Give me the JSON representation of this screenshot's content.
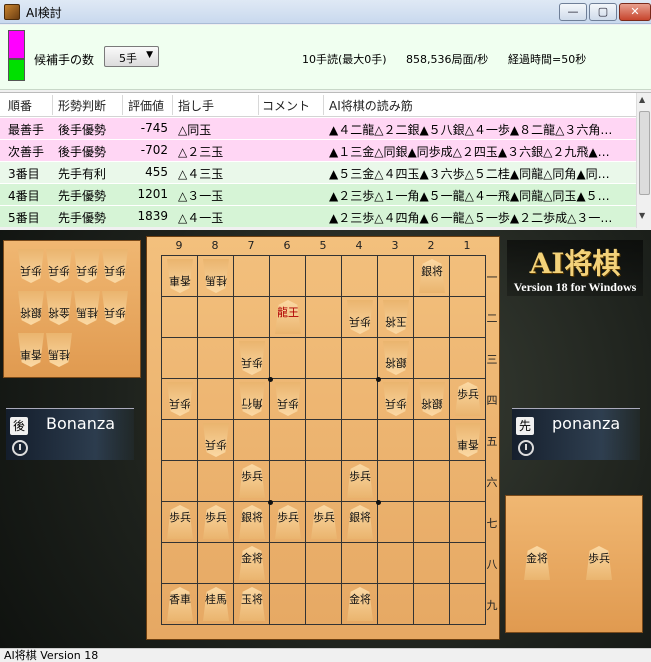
{
  "window": {
    "title": "AI検討",
    "min_label": "—",
    "max_label": "▢",
    "close_label": "✕"
  },
  "info": {
    "swatch_top_color": "#ff00ff",
    "swatch_bottom_color": "#00e000",
    "candidates_label": "候補手の数",
    "candidates_value": "5手",
    "candidates_arrow": "▼",
    "depth": "10手読(最大0手)",
    "speed": "858,536局面/秒",
    "elapsed": "経過時間=50秒"
  },
  "table": {
    "headers": [
      "順番",
      "形勢判断",
      "評価値",
      "指し手",
      "コメント",
      "AI将棋の読み筋"
    ],
    "rows": [
      {
        "rank": "最善手",
        "judge": "後手優勢",
        "value": "-745",
        "move": "△同玉",
        "pv": "▲４二龍△２二銀▲５八銀△４一歩▲８二龍△３六角…",
        "bg": "#ffd6f4"
      },
      {
        "rank": "次善手",
        "judge": "後手優勢",
        "value": "-702",
        "move": "△２三玉",
        "pv": "▲１三金△同銀▲同歩成△２四玉▲３六銀△２九飛▲…",
        "bg": "#ffd6f4"
      },
      {
        "rank": "3番目",
        "judge": "先手有利",
        "value": "455",
        "move": "△４三玉",
        "pv": "▲５三金△４四玉▲３六歩△５二桂▲同龍△同角▲同…",
        "bg": "#eaf8ea"
      },
      {
        "rank": "4番目",
        "judge": "先手優勢",
        "value": "1201",
        "move": "△３一玉",
        "pv": "▲２三歩△１一角▲５一龍△４一飛▲同龍△同玉▲５…",
        "bg": "#d6f4d6"
      },
      {
        "rank": "5番目",
        "judge": "先手優勢",
        "value": "1839",
        "move": "△４一玉",
        "pv": "▲２三歩△４四角▲６一龍△５一歩▲２二歩成△３一…",
        "bg": "#d6f4d6"
      }
    ],
    "scroll_up": "▲",
    "scroll_down": "▼"
  },
  "game": {
    "logo_title": "AI将棋",
    "logo_version": "Version 18 for Windows",
    "gote": {
      "tag": "後",
      "name": "Bonanza"
    },
    "sente": {
      "tag": "先",
      "name": "ponanza"
    },
    "col_labels": [
      "9",
      "8",
      "7",
      "6",
      "5",
      "4",
      "3",
      "2",
      "1"
    ],
    "row_labels": [
      "一",
      "二",
      "三",
      "四",
      "五",
      "六",
      "七",
      "八",
      "九"
    ],
    "board": [
      {
        "file": 9,
        "rank": 1,
        "t": "香車",
        "side": "gote"
      },
      {
        "file": 8,
        "rank": 1,
        "t": "桂馬",
        "side": "gote"
      },
      {
        "file": 2,
        "rank": 1,
        "t": "銀将",
        "side": "sente"
      },
      {
        "file": 6,
        "rank": 2,
        "t": "龍王",
        "side": "sente",
        "red": true
      },
      {
        "file": 4,
        "rank": 2,
        "t": "歩兵",
        "side": "gote"
      },
      {
        "file": 3,
        "rank": 2,
        "t": "玉将",
        "side": "gote"
      },
      {
        "file": 7,
        "rank": 3,
        "t": "歩兵",
        "side": "gote"
      },
      {
        "file": 3,
        "rank": 3,
        "t": "銀将",
        "side": "gote"
      },
      {
        "file": 9,
        "rank": 4,
        "t": "歩兵",
        "side": "gote"
      },
      {
        "file": 7,
        "rank": 4,
        "t": "角行",
        "side": "gote"
      },
      {
        "file": 6,
        "rank": 4,
        "t": "歩兵",
        "side": "gote"
      },
      {
        "file": 3,
        "rank": 4,
        "t": "歩兵",
        "side": "gote"
      },
      {
        "file": 2,
        "rank": 4,
        "t": "銀将",
        "side": "gote"
      },
      {
        "file": 1,
        "rank": 4,
        "t": "歩兵",
        "side": "sente"
      },
      {
        "file": 8,
        "rank": 5,
        "t": "歩兵",
        "side": "gote"
      },
      {
        "file": 1,
        "rank": 5,
        "t": "香車",
        "side": "gote"
      },
      {
        "file": 7,
        "rank": 6,
        "t": "歩兵",
        "side": "sente"
      },
      {
        "file": 4,
        "rank": 6,
        "t": "歩兵",
        "side": "sente"
      },
      {
        "file": 9,
        "rank": 7,
        "t": "歩兵",
        "side": "sente"
      },
      {
        "file": 8,
        "rank": 7,
        "t": "歩兵",
        "side": "sente"
      },
      {
        "file": 7,
        "rank": 7,
        "t": "銀将",
        "side": "sente"
      },
      {
        "file": 6,
        "rank": 7,
        "t": "歩兵",
        "side": "sente"
      },
      {
        "file": 5,
        "rank": 7,
        "t": "歩兵",
        "side": "sente"
      },
      {
        "file": 4,
        "rank": 7,
        "t": "銀将",
        "side": "sente"
      },
      {
        "file": 7,
        "rank": 8,
        "t": "金将",
        "side": "sente"
      },
      {
        "file": 9,
        "rank": 9,
        "t": "香車",
        "side": "sente"
      },
      {
        "file": 8,
        "rank": 9,
        "t": "桂馬",
        "side": "sente"
      },
      {
        "file": 7,
        "rank": 9,
        "t": "玉将",
        "side": "sente"
      },
      {
        "file": 4,
        "rank": 9,
        "t": "金将",
        "side": "sente"
      }
    ],
    "gote_hand": [
      {
        "t": "歩兵"
      },
      {
        "t": "歩兵"
      },
      {
        "t": "歩兵"
      },
      {
        "t": "歩兵"
      },
      {
        "t": "銀将"
      },
      {
        "t": "金将"
      },
      {
        "t": "桂馬"
      },
      {
        "t": "歩兵"
      },
      {
        "t": "香車"
      },
      {
        "t": "桂馬"
      }
    ],
    "sente_hand": [
      {
        "t": "金将"
      },
      {
        "t": "歩兵"
      }
    ]
  },
  "status": {
    "text": "AI将棋 Version 18"
  }
}
